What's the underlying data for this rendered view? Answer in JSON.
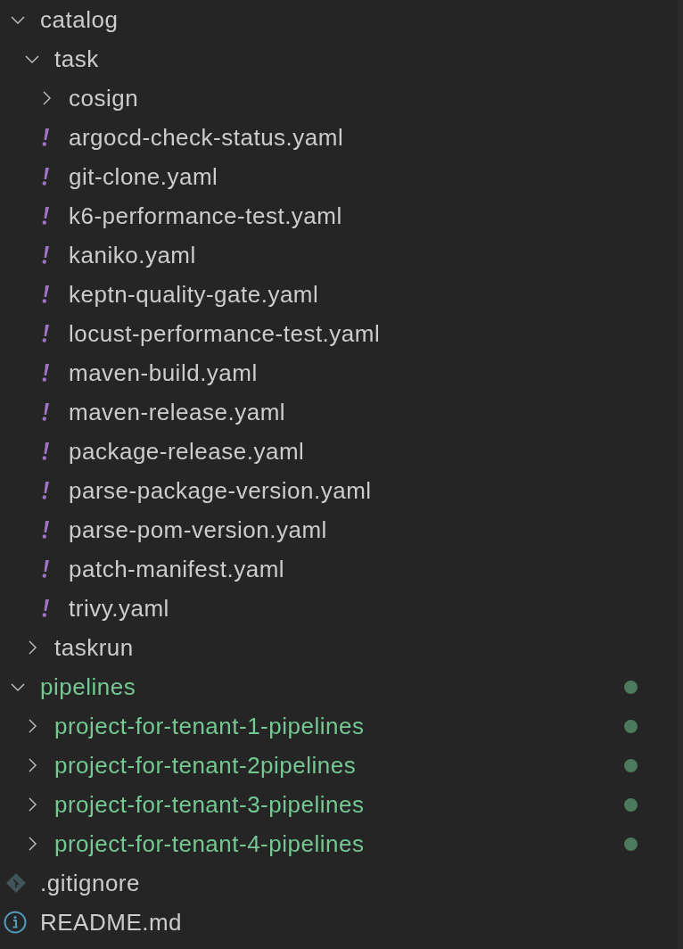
{
  "tree": [
    {
      "kind": "folder",
      "name": "catalog",
      "expanded": true,
      "changed": false,
      "children": [
        {
          "kind": "folder",
          "name": "task",
          "expanded": true,
          "changed": false,
          "children": [
            {
              "kind": "folder",
              "name": "cosign",
              "expanded": false,
              "changed": false
            },
            {
              "kind": "yaml",
              "name": "argocd-check-status.yaml",
              "changed": false
            },
            {
              "kind": "yaml",
              "name": "git-clone.yaml",
              "changed": false
            },
            {
              "kind": "yaml",
              "name": "k6-performance-test.yaml",
              "changed": false
            },
            {
              "kind": "yaml",
              "name": "kaniko.yaml",
              "changed": false
            },
            {
              "kind": "yaml",
              "name": "keptn-quality-gate.yaml",
              "changed": false
            },
            {
              "kind": "yaml",
              "name": "locust-performance-test.yaml",
              "changed": false
            },
            {
              "kind": "yaml",
              "name": "maven-build.yaml",
              "changed": false
            },
            {
              "kind": "yaml",
              "name": "maven-release.yaml",
              "changed": false
            },
            {
              "kind": "yaml",
              "name": "package-release.yaml",
              "changed": false
            },
            {
              "kind": "yaml",
              "name": "parse-package-version.yaml",
              "changed": false
            },
            {
              "kind": "yaml",
              "name": "parse-pom-version.yaml",
              "changed": false
            },
            {
              "kind": "yaml",
              "name": "patch-manifest.yaml",
              "changed": false
            },
            {
              "kind": "yaml",
              "name": "trivy.yaml",
              "changed": false
            }
          ]
        },
        {
          "kind": "folder",
          "name": "taskrun",
          "expanded": false,
          "changed": false
        }
      ]
    },
    {
      "kind": "folder",
      "name": "pipelines",
      "expanded": true,
      "changed": true,
      "children": [
        {
          "kind": "folder",
          "name": "project-for-tenant-1-pipelines",
          "expanded": false,
          "changed": true
        },
        {
          "kind": "folder",
          "name": "project-for-tenant-2pipelines",
          "expanded": false,
          "changed": true
        },
        {
          "kind": "folder",
          "name": "project-for-tenant-3-pipelines",
          "expanded": false,
          "changed": true
        },
        {
          "kind": "folder",
          "name": "project-for-tenant-4-pipelines",
          "expanded": false,
          "changed": true
        }
      ]
    },
    {
      "kind": "git",
      "name": ".gitignore",
      "changed": false
    },
    {
      "kind": "info",
      "name": "README.md",
      "changed": false
    }
  ]
}
